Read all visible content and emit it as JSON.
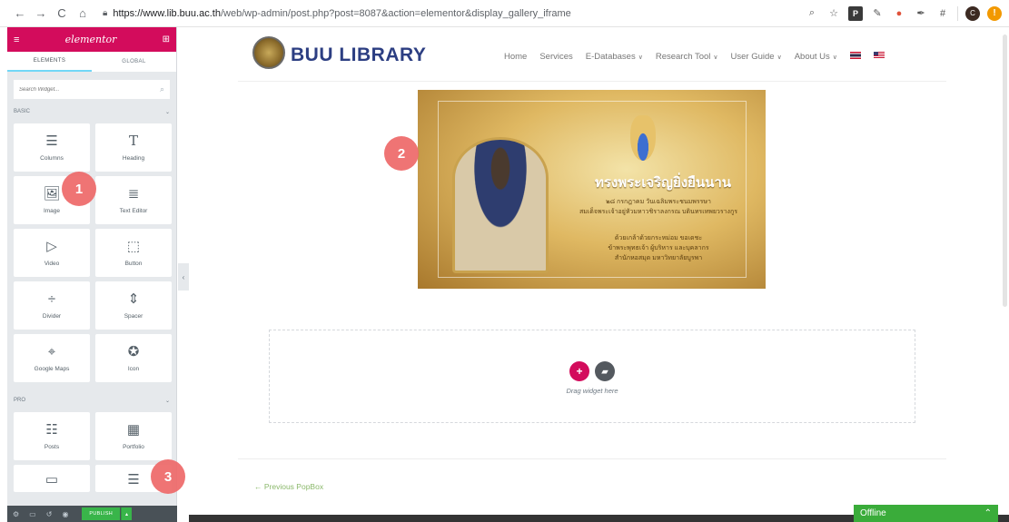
{
  "browser": {
    "url_host": "https://www.lib.buu.ac.th",
    "url_rest": "/web/wp-admin/post.php?post=8087&action=elementor&display_gallery_iframe"
  },
  "panel": {
    "logo": "elementor",
    "tabs": [
      "ELEMENTS",
      "GLOBAL"
    ],
    "search_placeholder": "Search Widget...",
    "sections": {
      "basic": "BASIC",
      "pro": "PRO"
    },
    "widgets_basic": [
      {
        "label": "Columns",
        "icon": "columns-icon"
      },
      {
        "label": "Heading",
        "icon": "heading-icon"
      },
      {
        "label": "Image",
        "icon": "image-icon"
      },
      {
        "label": "Text Editor",
        "icon": "text-editor-icon"
      },
      {
        "label": "Video",
        "icon": "video-icon"
      },
      {
        "label": "Button",
        "icon": "button-icon"
      },
      {
        "label": "Divider",
        "icon": "divider-icon"
      },
      {
        "label": "Spacer",
        "icon": "spacer-icon"
      },
      {
        "label": "Google Maps",
        "icon": "map-icon"
      },
      {
        "label": "Icon",
        "icon": "star-icon"
      }
    ],
    "widgets_pro": [
      {
        "label": "Posts",
        "icon": "posts-icon"
      },
      {
        "label": "Portfolio",
        "icon": "portfolio-icon"
      },
      {
        "label": "",
        "icon": "slides-icon"
      },
      {
        "label": "",
        "icon": "form-icon"
      }
    ],
    "footer": {
      "publish_label": "PUBLISH"
    }
  },
  "site": {
    "logo_text": "BUU LIBRARY",
    "nav": [
      {
        "label": "Home",
        "dropdown": false
      },
      {
        "label": "Services",
        "dropdown": false
      },
      {
        "label": "E-Databases",
        "dropdown": true
      },
      {
        "label": "Research Tool",
        "dropdown": true
      },
      {
        "label": "User Guide",
        "dropdown": true
      },
      {
        "label": "About Us",
        "dropdown": true
      }
    ],
    "banner": {
      "title": "ทรงพระเจริญยิ่งยืนนาน",
      "line1": "๒๘ กรกฎาคม วันเฉลิมพระชนมพรรษา",
      "line2": "สมเด็จพระเจ้าอยู่หัวมหาวชิราลงกรณ บดินทรเทพยวรางกูร",
      "line3": "ด้วยเกล้าด้วยกระหม่อม ขอเดชะ",
      "line4": "ข้าพระพุทธเจ้า ผู้บริหาร และบุคลากร",
      "line5": "สำนักหอสมุด มหาวิทยาลัยบูรพา"
    },
    "dropzone_text": "Drag widget here",
    "prev_link": "← Previous PopBox"
  },
  "offline_label": "Offline",
  "callouts": [
    "1",
    "2",
    "3"
  ]
}
